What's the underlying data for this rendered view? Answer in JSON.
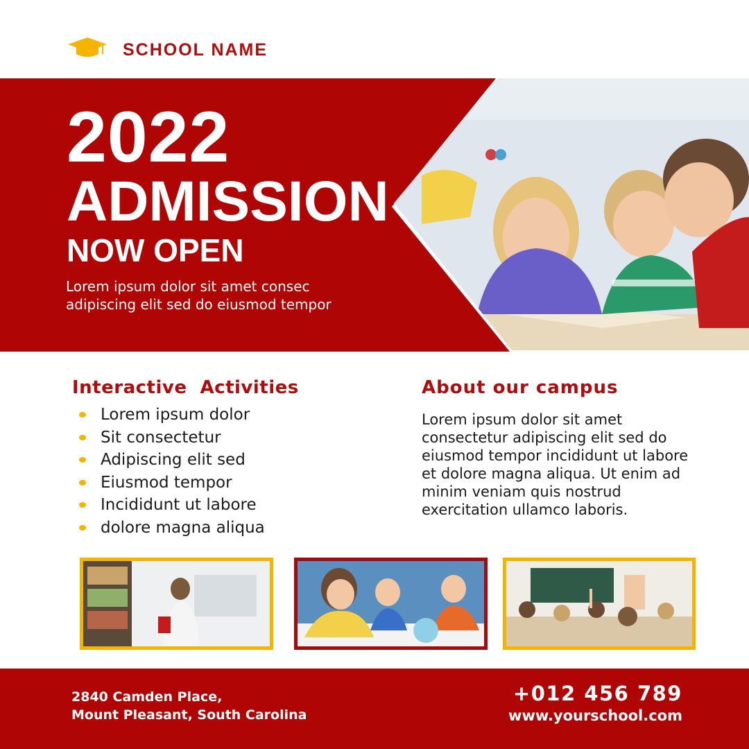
{
  "header": {
    "logo_icon": "graduation-cap-icon",
    "school_name": "SCHOOL NAME"
  },
  "hero": {
    "year": "2022",
    "headline": "ADMISSION",
    "subheadline": "NOW OPEN",
    "description": "Lorem ipsum dolor sit amet consec adipiscing elit sed do eiusmod tempor"
  },
  "activities": {
    "title": "Interactive  Activities",
    "items": [
      "Lorem ipsum dolor",
      "Sit consectetur",
      "Adipiscing elit sed",
      "Eiusmod tempor",
      "Incididunt ut labore",
      "dolore magna aliqua"
    ]
  },
  "campus": {
    "title": "About our campus",
    "text": "Lorem ipsum dolor sit amet consectetur adipiscing elit sed do eiusmod tempor incididunt ut labore et dolore magna aliqua. Ut enim ad minim veniam quis nostrud exercitation ullamco laboris."
  },
  "footer": {
    "address_line1": "2840 Camden Place,",
    "address_line2": "Mount Pleasant, South Carolina",
    "phone": "+012 456 789",
    "website": "www.yourschool.com"
  },
  "colors": {
    "brand_red": "#b00505",
    "accent_yellow": "#f4b400"
  }
}
